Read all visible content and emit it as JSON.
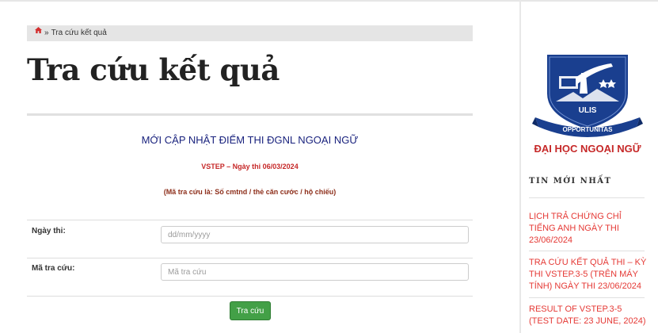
{
  "breadcrumb": {
    "separator": "»",
    "current": "Tra cứu kết quả"
  },
  "page_title": "Tra cứu kết quả",
  "notice": {
    "heading": "MỚI CẬP NHẬT ĐIỂM THI ĐGNL NGOẠI NGỮ",
    "vstep_line": "VSTEP – Ngày thi 06/03/2024",
    "code_note": "(Mã tra cứu là:  Số cmtnd / thẻ căn cước / hộ chiếu)"
  },
  "form": {
    "date_label": "Ngày thi:",
    "date_placeholder": "dd/mm/yyyy",
    "date_value": "",
    "code_label": "Mã tra cứu:",
    "code_placeholder": "Mã tra cứu",
    "code_value": "",
    "submit_label": "Tra cứu"
  },
  "sidebar": {
    "logo_text": {
      "ulis": "ULIS",
      "motto": "OPPORTUNITAS",
      "name": "ĐẠI HỌC NGOẠI NGỮ"
    },
    "heading": "TIN MỚI NHẤT",
    "news": [
      "LỊCH TRẢ CHỨNG CHỈ TIẾNG ANH NGÀY THI 23/06/2024",
      "TRA CỨU KẾT QUẢ THI – KỲ THI VSTEP.3-5 (TRÊN MÁY TÍNH) NGÀY THI 23/06/2024",
      "RESULT OF VSTEP.3-5 (TEST DATE: 23 JUNE, 2024)"
    ]
  },
  "colors": {
    "brand_navy": "#1a3f8f",
    "brand_red": "#c62828",
    "link_red": "#e53935",
    "button_green": "#43a047"
  }
}
